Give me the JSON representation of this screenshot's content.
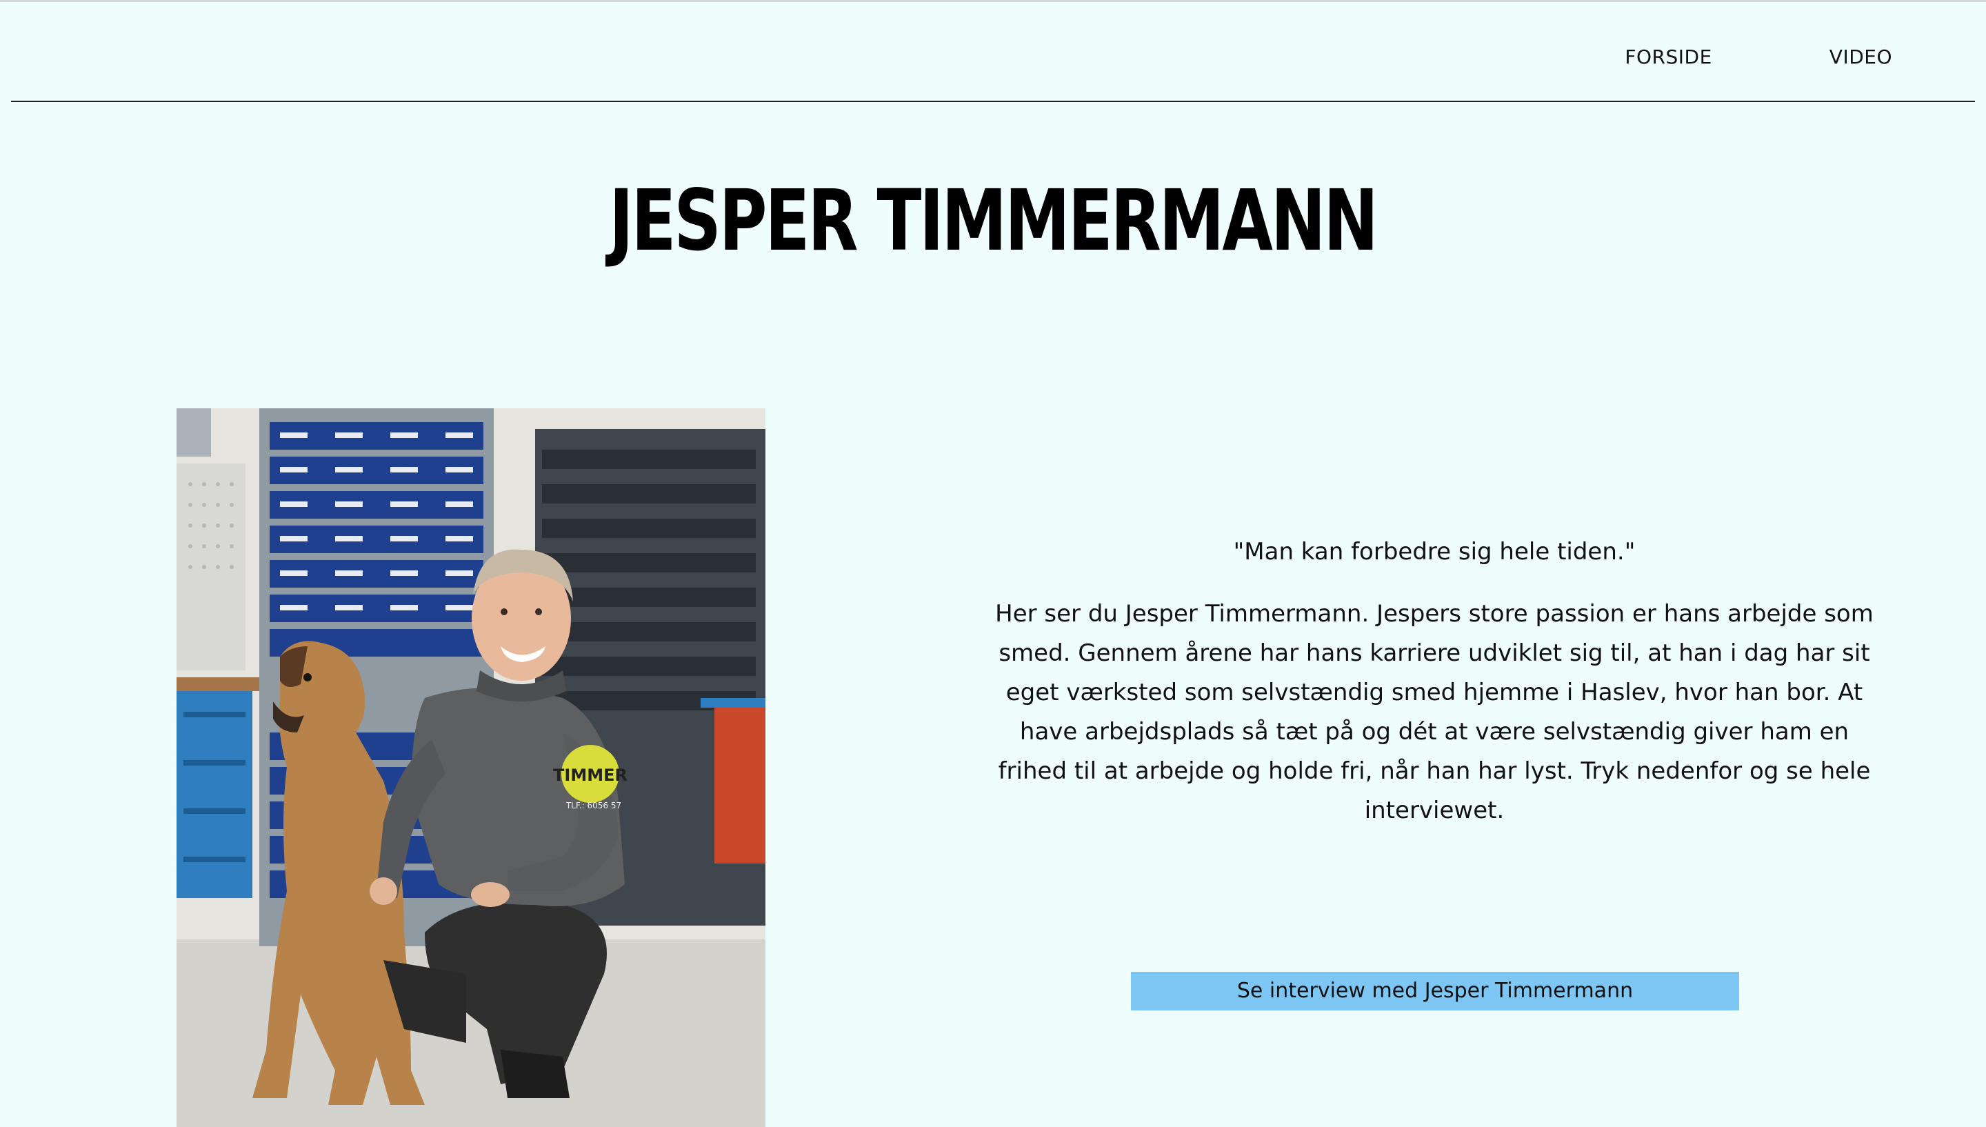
{
  "nav": {
    "items": [
      {
        "label": "FORSIDE"
      },
      {
        "label": "VIDEO"
      }
    ]
  },
  "page": {
    "title": "JESPER TIMMERMANN"
  },
  "photo": {
    "badge_text": "TIMMER",
    "badge_subtext": "TLF.: 6056 57"
  },
  "content": {
    "quote": "\"Man kan forbedre sig hele tiden.\"",
    "body": "Her ser du Jesper Timmermann. Jespers store passion er hans arbejde som smed. Gennem årene har hans karriere udviklet sig til, at han i dag har sit eget værksted som selvstændig smed hjemme i Haslev, hvor han bor. At have arbejdsplads så tæt på og dét at være selvstændig giver ham en frihed til at arbejde og holde fri, når han har lyst. Tryk nedenfor og se hele interviewet."
  },
  "cta": {
    "label": "Se interview med Jesper Timmermann"
  },
  "colors": {
    "background": "#effefd",
    "button": "#7ec7f4",
    "rule": "#222222"
  }
}
